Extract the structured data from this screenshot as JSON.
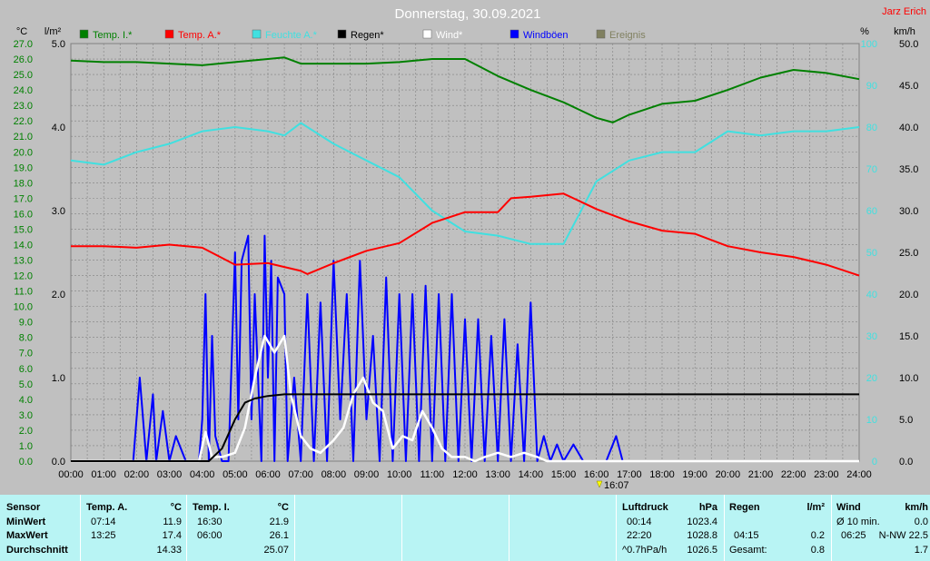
{
  "header": {
    "title": "Donnerstag, 30.09.2021",
    "author": "Jarz Erich"
  },
  "axis_units": {
    "temp": "°C",
    "rain": "l/m²",
    "humidity": "%",
    "wind": "km/h"
  },
  "legend": [
    {
      "label": "Temp. I.*",
      "color": "#008000"
    },
    {
      "label": "Temp. A.*",
      "color": "#ff0000"
    },
    {
      "label": "Feuchte A.*",
      "color": "#40e0e0"
    },
    {
      "label": "Regen*",
      "color": "#000000"
    },
    {
      "label": "Wind*",
      "color": "#ffffff"
    },
    {
      "label": "Windböen",
      "color": "#0000ff"
    },
    {
      "label": "Ereignis",
      "color": "#808060"
    }
  ],
  "event_marker": "16:07",
  "chart_data": {
    "type": "line",
    "x_ticks": [
      "00:00",
      "01:00",
      "02:00",
      "03:00",
      "04:00",
      "05:00",
      "06:00",
      "07:00",
      "08:00",
      "09:00",
      "10:00",
      "11:00",
      "12:00",
      "13:00",
      "14:00",
      "15:00",
      "16:00",
      "17:00",
      "18:00",
      "19:00",
      "20:00",
      "21:00",
      "22:00",
      "23:00",
      "24:00"
    ],
    "temp_ticks": [
      "27.0",
      "26.0",
      "25.0",
      "24.0",
      "23.0",
      "22.0",
      "21.0",
      "20.0",
      "19.0",
      "18.0",
      "17.0",
      "16.0",
      "15.0",
      "14.0",
      "13.0",
      "12.0",
      "11.0",
      "10.0",
      "9.0",
      "8.0",
      "7.0",
      "6.0",
      "5.0",
      "4.0",
      "3.0",
      "2.0",
      "1.0",
      "0.0"
    ],
    "rain_ticks": [
      "5.0",
      "4.0",
      "3.0",
      "2.0",
      "1.0",
      "0.0"
    ],
    "humidity_ticks": [
      "100",
      "90",
      "80",
      "70",
      "60",
      "50",
      "40",
      "30",
      "20",
      "10",
      "0"
    ],
    "wind_ticks": [
      "50.0",
      "45.0",
      "40.0",
      "35.0",
      "30.0",
      "25.0",
      "20.0",
      "15.0",
      "10.0",
      "5.0",
      "0.0"
    ],
    "ylim_temp": [
      0,
      27
    ],
    "ylim_rain": [
      0,
      5
    ],
    "ylim_humidity": [
      0,
      100
    ],
    "ylim_wind": [
      0,
      50
    ],
    "series": [
      {
        "name": "Temp. I.*",
        "axis": "temp",
        "color": "#008000",
        "x": [
          0,
          1,
          2,
          3,
          4,
          5,
          6,
          6.5,
          7,
          8,
          9,
          10,
          11,
          12,
          13,
          14,
          15,
          16,
          16.5,
          17,
          18,
          19,
          20,
          21,
          22,
          23,
          24
        ],
        "y": [
          25.9,
          25.8,
          25.8,
          25.7,
          25.6,
          25.8,
          26.0,
          26.1,
          25.7,
          25.7,
          25.7,
          25.8,
          26.0,
          26.0,
          24.9,
          24.0,
          23.2,
          22.2,
          21.9,
          22.4,
          23.1,
          23.3,
          24.0,
          24.8,
          25.3,
          25.1,
          24.7
        ]
      },
      {
        "name": "Temp. A.*",
        "axis": "temp",
        "color": "#ff0000",
        "x": [
          0,
          1,
          2,
          3,
          4,
          5,
          6,
          7,
          7.2,
          8,
          9,
          10,
          11,
          12,
          13,
          13.4,
          14,
          15,
          16,
          17,
          18,
          19,
          20,
          21,
          22,
          23,
          24
        ],
        "y": [
          13.9,
          13.9,
          13.8,
          14.0,
          13.8,
          12.7,
          12.8,
          12.3,
          12.1,
          12.8,
          13.6,
          14.1,
          15.4,
          16.1,
          16.1,
          17.0,
          17.1,
          17.3,
          16.3,
          15.5,
          14.9,
          14.7,
          13.9,
          13.5,
          13.2,
          12.7,
          12.0
        ]
      },
      {
        "name": "Feuchte A.*",
        "axis": "humidity",
        "color": "#40e0e0",
        "x": [
          0,
          1,
          2,
          3,
          4,
          5,
          6,
          6.5,
          7,
          8,
          9,
          10,
          11,
          12,
          13,
          14,
          15,
          16,
          17,
          18,
          19,
          20,
          21,
          22,
          23,
          24
        ],
        "y": [
          72,
          71,
          74,
          76,
          79,
          80,
          79,
          78,
          81,
          76,
          72,
          68,
          60,
          55,
          54,
          52,
          52,
          67,
          72,
          74,
          74,
          79,
          78,
          79,
          79,
          80
        ]
      },
      {
        "name": "Regen*",
        "axis": "rain",
        "color": "#000000",
        "x": [
          0,
          4.2,
          4.6,
          5,
          5.3,
          5.6,
          6,
          6.5,
          7,
          24
        ],
        "y": [
          0,
          0,
          0.15,
          0.5,
          0.7,
          0.75,
          0.78,
          0.8,
          0.8,
          0.8
        ]
      },
      {
        "name": "Wind*",
        "axis": "wind",
        "color": "#ffffff",
        "x": [
          0,
          3.9,
          4.1,
          4.3,
          4.6,
          5,
          5.3,
          5.6,
          5.9,
          6.2,
          6.5,
          6.7,
          7,
          7.3,
          7.6,
          8,
          8.3,
          8.6,
          8.9,
          9.2,
          9.5,
          9.8,
          10.1,
          10.4,
          10.7,
          11,
          11.3,
          11.6,
          12,
          12.3,
          12.6,
          13,
          13.4,
          13.8,
          14.2,
          14.5,
          15,
          24
        ],
        "y": [
          0,
          0,
          3.5,
          0.5,
          0.5,
          1,
          4,
          10,
          15,
          13,
          15,
          8,
          3,
          1.5,
          1,
          2.5,
          4,
          8,
          10,
          7,
          6,
          1.5,
          3,
          2.5,
          6,
          4,
          1.5,
          0.5,
          0.5,
          0,
          0.5,
          1,
          0.5,
          1,
          0.5,
          0,
          0,
          0
        ]
      },
      {
        "name": "Windböen",
        "axis": "wind",
        "color": "#0000ff",
        "x": [
          0,
          1.9,
          2.1,
          2.3,
          2.5,
          2.6,
          2.8,
          3,
          3.2,
          3.5,
          3.9,
          4,
          4.1,
          4.2,
          4.3,
          4.4,
          4.6,
          4.8,
          5,
          5.1,
          5.2,
          5.4,
          5.5,
          5.6,
          5.8,
          5.9,
          6,
          6.1,
          6.2,
          6.3,
          6.5,
          6.6,
          6.8,
          7,
          7.2,
          7.4,
          7.6,
          7.8,
          8,
          8.2,
          8.4,
          8.6,
          8.8,
          9,
          9.2,
          9.4,
          9.6,
          9.8,
          10,
          10.2,
          10.4,
          10.6,
          10.8,
          11,
          11.2,
          11.4,
          11.6,
          11.8,
          12,
          12.2,
          12.4,
          12.6,
          12.8,
          13,
          13.2,
          13.4,
          13.6,
          13.8,
          14,
          14.2,
          14.4,
          14.6,
          14.8,
          15,
          15.3,
          15.6,
          16,
          16.3,
          16.6,
          16.8,
          17,
          17.2,
          24
        ],
        "y": [
          0,
          0,
          10,
          0,
          8,
          0,
          6,
          0,
          3,
          0,
          0,
          5,
          20,
          0,
          15,
          3,
          0,
          0,
          25,
          5,
          24,
          27,
          5,
          20,
          0,
          27,
          10,
          24,
          0,
          22,
          20,
          0,
          10,
          0,
          20,
          0,
          19,
          0,
          24,
          5,
          20,
          0,
          24,
          5,
          15,
          0,
          22,
          0,
          20,
          0,
          20,
          0,
          21,
          0,
          20,
          0,
          20,
          0,
          17,
          0,
          17,
          0,
          15,
          0,
          17,
          0,
          14,
          0,
          19,
          0,
          3,
          0,
          2,
          0,
          2,
          0,
          0,
          0,
          3,
          0,
          0,
          0,
          0
        ]
      }
    ]
  },
  "table": {
    "sensor_label": "Sensor",
    "rows": [
      "MinWert",
      "MaxWert",
      "Durchschnitt"
    ],
    "temp_a": {
      "title": "Temp. A.",
      "unit": "°C",
      "rows": [
        [
          "07:14",
          "11.9"
        ],
        [
          "13:25",
          "17.4"
        ],
        [
          "",
          "14.33"
        ]
      ]
    },
    "temp_i": {
      "title": "Temp. I.",
      "unit": "°C",
      "rows": [
        [
          "16:30",
          "21.9"
        ],
        [
          "06:00",
          "26.1"
        ],
        [
          "",
          "25.07"
        ]
      ]
    },
    "pressure": {
      "title": "Luftdruck",
      "unit": "hPa",
      "rows": [
        [
          "00:14",
          "1023.4"
        ],
        [
          "22:20",
          "1028.8"
        ],
        [
          "^0.7hPa/h",
          "1026.5"
        ]
      ]
    },
    "rain": {
      "title": "Regen",
      "unit": "l/m²",
      "rows": [
        [
          "",
          ""
        ],
        [
          "04:15",
          "0.2"
        ],
        [
          "Gesamt:",
          "0.8"
        ]
      ]
    },
    "wind": {
      "title": "Wind",
      "unit": "km/h",
      "rows": [
        [
          "Ø 10 min.",
          "0.0"
        ],
        [
          "06:25",
          "N-NW 22.5"
        ],
        [
          "",
          "1.7"
        ]
      ]
    }
  }
}
